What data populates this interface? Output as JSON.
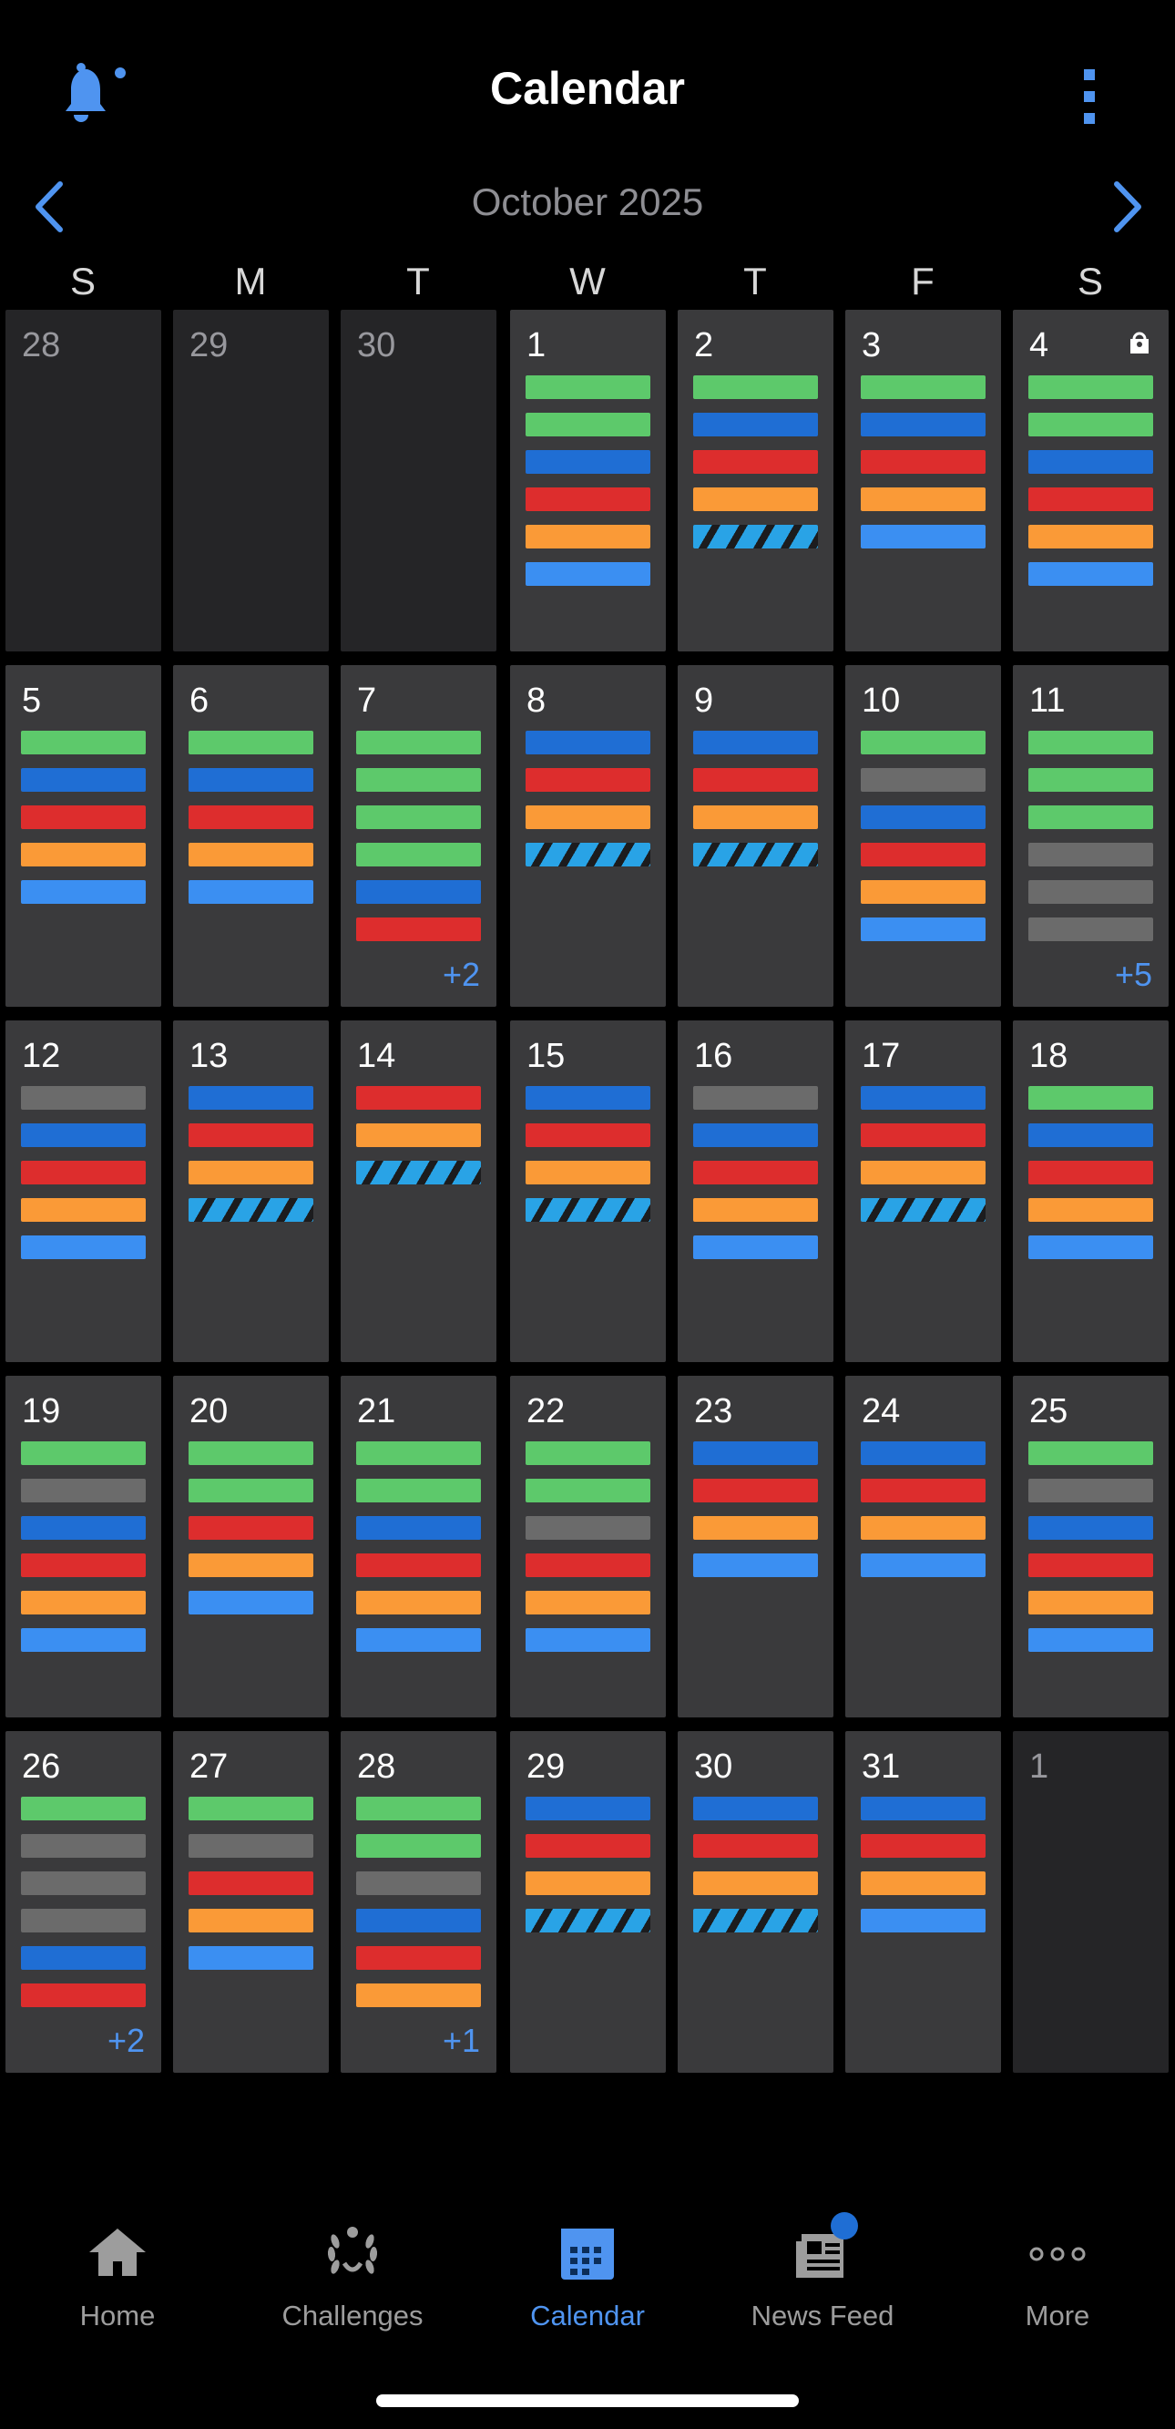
{
  "header": {
    "title": "Calendar",
    "icons": [
      "bell-icon",
      "more-vertical-icon"
    ]
  },
  "calendar": {
    "month_label": "October 2025",
    "weekdays": [
      "S",
      "M",
      "T",
      "W",
      "T",
      "F",
      "S"
    ],
    "colors": {
      "green": "#5dc96b",
      "blue": "#1f6ed4",
      "red": "#dd2d2d",
      "orange": "#fa9a37",
      "light_blue": "#3b8ff2",
      "gray": "#6b6b6b",
      "striped": "#29a3e6"
    },
    "days": [
      {
        "num": "28",
        "muted": true,
        "bars": []
      },
      {
        "num": "29",
        "muted": true,
        "bars": []
      },
      {
        "num": "30",
        "muted": true,
        "bars": []
      },
      {
        "num": "1",
        "bars": [
          "green",
          "green",
          "blue",
          "red",
          "orange",
          "light_blue"
        ]
      },
      {
        "num": "2",
        "bars": [
          "green",
          "blue",
          "red",
          "orange",
          "striped"
        ]
      },
      {
        "num": "3",
        "bars": [
          "green",
          "blue",
          "red",
          "orange",
          "light_blue"
        ]
      },
      {
        "num": "4",
        "badge": "bag-icon",
        "bars": [
          "green",
          "green",
          "blue",
          "red",
          "orange",
          "light_blue"
        ]
      },
      {
        "num": "5",
        "bars": [
          "green",
          "blue",
          "red",
          "orange",
          "light_blue"
        ]
      },
      {
        "num": "6",
        "bars": [
          "green",
          "blue",
          "red",
          "orange",
          "light_blue"
        ]
      },
      {
        "num": "7",
        "bars": [
          "green",
          "green",
          "green",
          "green",
          "blue",
          "red"
        ],
        "more": "+2"
      },
      {
        "num": "8",
        "bars": [
          "blue",
          "red",
          "orange",
          "striped"
        ]
      },
      {
        "num": "9",
        "bars": [
          "blue",
          "red",
          "orange",
          "striped"
        ]
      },
      {
        "num": "10",
        "bars": [
          "green",
          "gray",
          "blue",
          "red",
          "orange",
          "light_blue"
        ]
      },
      {
        "num": "11",
        "bars": [
          "green",
          "green",
          "green",
          "gray",
          "gray",
          "gray"
        ],
        "more": "+5"
      },
      {
        "num": "12",
        "bars": [
          "gray",
          "blue",
          "red",
          "orange",
          "light_blue"
        ]
      },
      {
        "num": "13",
        "bars": [
          "blue",
          "red",
          "orange",
          "striped"
        ]
      },
      {
        "num": "14",
        "bars": [
          "red",
          "orange",
          "striped"
        ]
      },
      {
        "num": "15",
        "bars": [
          "blue",
          "red",
          "orange",
          "striped"
        ]
      },
      {
        "num": "16",
        "bars": [
          "gray",
          "blue",
          "red",
          "orange",
          "light_blue"
        ]
      },
      {
        "num": "17",
        "bars": [
          "blue",
          "red",
          "orange",
          "striped"
        ]
      },
      {
        "num": "18",
        "bars": [
          "green",
          "blue",
          "red",
          "orange",
          "light_blue"
        ]
      },
      {
        "num": "19",
        "bars": [
          "green",
          "gray",
          "blue",
          "red",
          "orange",
          "light_blue"
        ]
      },
      {
        "num": "20",
        "bars": [
          "green",
          "green",
          "red",
          "orange",
          "light_blue"
        ]
      },
      {
        "num": "21",
        "bars": [
          "green",
          "green",
          "blue",
          "red",
          "orange",
          "light_blue"
        ]
      },
      {
        "num": "22",
        "bars": [
          "green",
          "green",
          "gray",
          "red",
          "orange",
          "light_blue"
        ]
      },
      {
        "num": "23",
        "bars": [
          "blue",
          "red",
          "orange",
          "light_blue"
        ]
      },
      {
        "num": "24",
        "bars": [
          "blue",
          "red",
          "orange",
          "light_blue"
        ]
      },
      {
        "num": "25",
        "bars": [
          "green",
          "gray",
          "blue",
          "red",
          "orange",
          "light_blue"
        ]
      },
      {
        "num": "26",
        "bars": [
          "green",
          "gray",
          "gray",
          "gray",
          "blue",
          "red"
        ],
        "more": "+2"
      },
      {
        "num": "27",
        "bars": [
          "green",
          "gray",
          "red",
          "orange",
          "light_blue"
        ]
      },
      {
        "num": "28",
        "bars": [
          "green",
          "green",
          "gray",
          "blue",
          "red",
          "orange"
        ],
        "more": "+1"
      },
      {
        "num": "29",
        "bars": [
          "blue",
          "red",
          "orange",
          "striped"
        ]
      },
      {
        "num": "30",
        "bars": [
          "blue",
          "red",
          "orange",
          "striped"
        ]
      },
      {
        "num": "31",
        "bars": [
          "blue",
          "red",
          "orange",
          "light_blue"
        ]
      },
      {
        "num": "1",
        "muted": true,
        "bars": []
      }
    ]
  },
  "tabbar": {
    "items": [
      {
        "label": "Home",
        "icon": "home-icon",
        "active": false
      },
      {
        "label": "Challenges",
        "icon": "laurel-icon",
        "active": false
      },
      {
        "label": "Calendar",
        "icon": "calendar-icon",
        "active": true
      },
      {
        "label": "News Feed",
        "icon": "newspaper-icon",
        "active": false,
        "dot": true
      },
      {
        "label": "More",
        "icon": "more-horizontal-icon",
        "active": false
      }
    ],
    "accent": "#4f94f0",
    "inactive": "#9d9d9d"
  }
}
